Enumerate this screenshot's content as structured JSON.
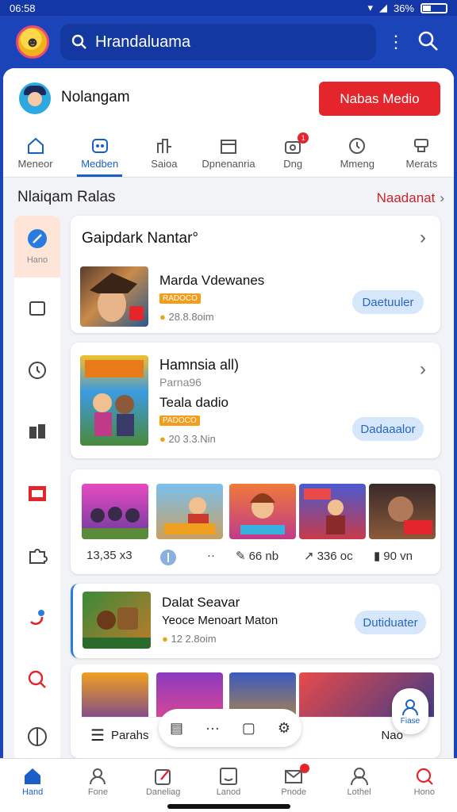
{
  "status": {
    "time": "06:58",
    "battery": "36%"
  },
  "app_bar": {
    "search_query": "Hrandaluama"
  },
  "profile": {
    "username": "Nolangam",
    "cta_label": "Nabas Medio"
  },
  "tabs": [
    {
      "label": "Meneor",
      "icon": "home-icon"
    },
    {
      "label": "Medben",
      "icon": "gamepad-icon",
      "active": true
    },
    {
      "label": "Saioa",
      "icon": "chart-icon"
    },
    {
      "label": "Dpnenanria",
      "icon": "calendar-icon"
    },
    {
      "label": "Dng",
      "icon": "gift-icon",
      "badge": "1"
    },
    {
      "label": "Mmeng",
      "icon": "clock-icon"
    },
    {
      "label": "Merats",
      "icon": "trophy-icon"
    }
  ],
  "section": {
    "title": "Nlaiqam Ralas",
    "link": "Naadanat"
  },
  "rail": [
    {
      "label": "Hano",
      "icon": "feather-icon",
      "active": true
    },
    {
      "label": "",
      "icon": "square-icon"
    },
    {
      "label": "",
      "icon": "clock-icon"
    },
    {
      "label": "",
      "icon": "book-icon"
    },
    {
      "label": "",
      "icon": "image-icon"
    },
    {
      "label": "",
      "icon": "puzzle-icon"
    },
    {
      "label": "",
      "icon": "link-icon"
    },
    {
      "label": "",
      "icon": "search-icon"
    },
    {
      "label": "",
      "icon": "globe-icon"
    }
  ],
  "card1": {
    "title": "Gaipdark Nantar°",
    "game_name": "Marda Vdewanes",
    "badge": "RADOCO",
    "meta": "28.8.8oim",
    "button": "Daetuuler"
  },
  "card2": {
    "title": "Hamnsia all)",
    "subtitle": "Parna96",
    "game_name": "Teala dadio",
    "badge": "PADOCO",
    "meta": "20 3.3.Nin",
    "button": "Dadaaalor"
  },
  "grid_stats": [
    {
      "value": "13,35 x3",
      "icon": ""
    },
    {
      "value": "",
      "icon": "shield-icon"
    },
    {
      "value": "··",
      "icon": ""
    },
    {
      "value": "66 nb",
      "icon": "pen-icon"
    },
    {
      "value": "336 oc",
      "icon": "arrow-icon"
    },
    {
      "value": "90 vn",
      "icon": "book-icon"
    }
  ],
  "card3": {
    "title": "Dalat Seavar",
    "subtitle": "Yeoce Menoart Maton",
    "meta": "12 2.8oim",
    "button": "Dutiduater"
  },
  "row_bar": {
    "label": "Parahs",
    "right_label": "Nao"
  },
  "float_pill": {
    "dots": "···"
  },
  "fab": {
    "label": "Fiase"
  },
  "bottom_nav": [
    {
      "label": "Hand",
      "icon": "home-icon",
      "active": true
    },
    {
      "label": "Fone",
      "icon": "person-icon"
    },
    {
      "label": "Daneliag",
      "icon": "edit-icon"
    },
    {
      "label": "Lanod",
      "icon": "smile-icon"
    },
    {
      "label": "Pnode",
      "icon": "mail-icon",
      "badge": true
    },
    {
      "label": "Lothel",
      "icon": "user-icon"
    },
    {
      "label": "Hono",
      "icon": "search-icon"
    }
  ]
}
